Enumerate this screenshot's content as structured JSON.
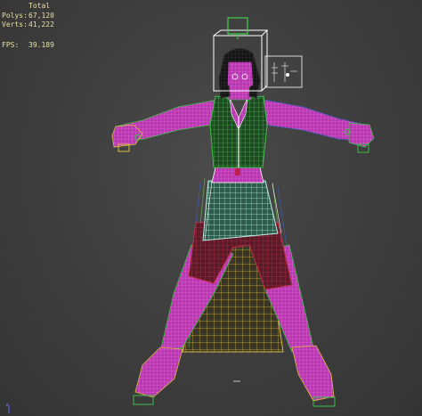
{
  "viewport": {
    "stats": {
      "title": "Total",
      "polys_label": "Polys:",
      "polys_value": "67,120",
      "verts_label": "Verts:",
      "verts_value": "41,222",
      "fps_label": "FPS:",
      "fps_value": "39.189"
    },
    "axis_label": "z"
  },
  "colors": {
    "background": "#3b3b3b",
    "skin_wire": "#d23fc8",
    "shirt_wire": "#3fbf4a",
    "skirt_wire": "#7fe0c0",
    "shorts_wire": "#c0304a",
    "rig_wire": "#d8c040",
    "helper_wire": "#ffffff",
    "stats_text": "#e8e0a0"
  }
}
